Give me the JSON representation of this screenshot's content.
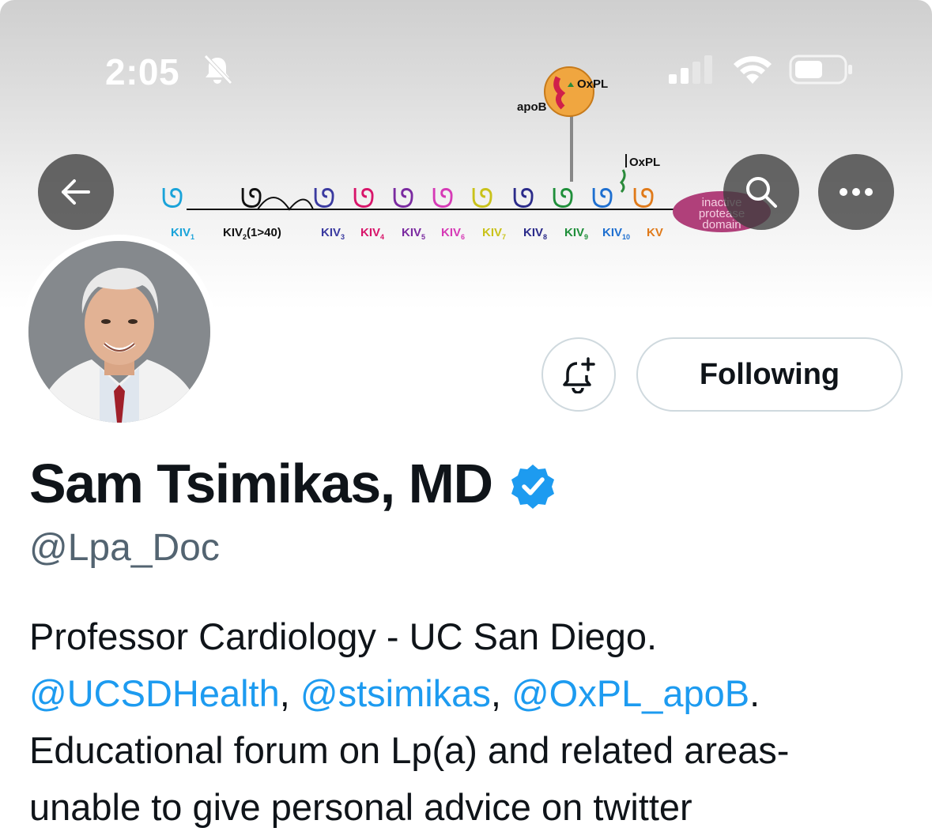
{
  "status_bar": {
    "time": "2:05"
  },
  "banner": {
    "diagram": {
      "oxpl_top": "OxPL",
      "apob": "apoB",
      "oxpl_mid": "OxPL",
      "inactive_domain_lines": [
        "inactive",
        "protease",
        "domain"
      ],
      "kringle_labels": [
        {
          "base": "KIV",
          "sub": "1",
          "suffix": "",
          "color": "#1aa3d9"
        },
        {
          "base": "KIV",
          "sub": "2",
          "suffix": "(1>40)",
          "color": "#111111"
        },
        {
          "base": "KIV",
          "sub": "3",
          "suffix": "",
          "color": "#3a3aa0"
        },
        {
          "base": "KIV",
          "sub": "4",
          "suffix": "",
          "color": "#d8156a"
        },
        {
          "base": "KIV",
          "sub": "5",
          "suffix": "",
          "color": "#7a2aa0"
        },
        {
          "base": "KIV",
          "sub": "6",
          "suffix": "",
          "color": "#d63ab6"
        },
        {
          "base": "KIV",
          "sub": "7",
          "suffix": "",
          "color": "#c9c21a"
        },
        {
          "base": "KIV",
          "sub": "8",
          "suffix": "",
          "color": "#2b2b8a"
        },
        {
          "base": "KIV",
          "sub": "9",
          "suffix": "",
          "color": "#1f8f3a"
        },
        {
          "base": "KIV",
          "sub": "10",
          "suffix": "",
          "color": "#1e6fd0"
        },
        {
          "base": "KV",
          "sub": "",
          "suffix": "",
          "color": "#e07a1a"
        }
      ]
    }
  },
  "header_actions": {
    "back_icon": "arrow-left-icon",
    "search_icon": "search-icon",
    "more_icon": "more-horizontal-icon"
  },
  "profile": {
    "display_name": "Sam Tsimikas, MD",
    "handle": "@Lpa_Doc",
    "verified": true,
    "verified_color": "#1d9bf0",
    "following_label": "Following",
    "notify_icon": "bell-plus-icon",
    "bio": {
      "line1": "Professor Cardiology - UC San Diego.",
      "mention1": "@UCSDHealth",
      "sep1": ", ",
      "mention2": "@stsimikas",
      "sep2": ", ",
      "mention3": "@OxPL_apoB",
      "end2": ".",
      "line3": "Educational forum on Lp(a) and related areas-",
      "line4": "unable to give personal advice on twitter"
    }
  },
  "colors": {
    "link": "#1d9bf0",
    "text": "#0f1419",
    "secondary": "#536471",
    "border": "#cfd9de"
  }
}
